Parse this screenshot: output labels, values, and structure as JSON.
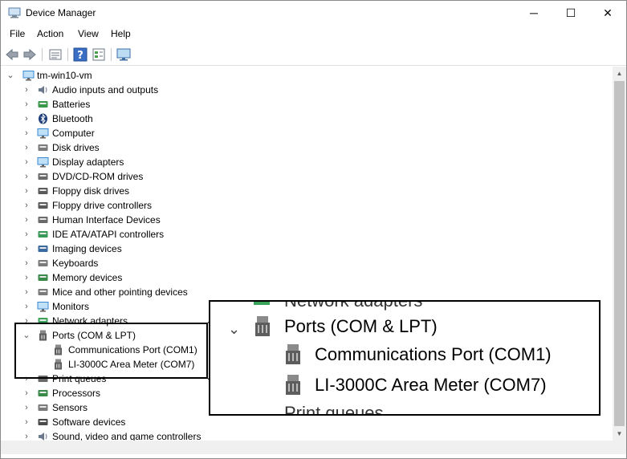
{
  "window": {
    "title": "Device Manager",
    "controls": {
      "minimize": "─",
      "maximize": "☐",
      "close": "✕"
    }
  },
  "menu": [
    "File",
    "Action",
    "View",
    "Help"
  ],
  "toolbar": [
    "back-icon",
    "forward-icon",
    "properties-icon",
    "help-icon",
    "view-icon",
    "monitor-icon"
  ],
  "tree": {
    "root": "tm-win10-vm",
    "categories": [
      {
        "label": "Audio inputs and outputs",
        "icon": "speaker-icon"
      },
      {
        "label": "Batteries",
        "icon": "battery-icon"
      },
      {
        "label": "Bluetooth",
        "icon": "bluetooth-icon"
      },
      {
        "label": "Computer",
        "icon": "computer-icon"
      },
      {
        "label": "Disk drives",
        "icon": "disk-icon"
      },
      {
        "label": "Display adapters",
        "icon": "display-icon"
      },
      {
        "label": "DVD/CD-ROM drives",
        "icon": "dvd-icon"
      },
      {
        "label": "Floppy disk drives",
        "icon": "floppy-icon"
      },
      {
        "label": "Floppy drive controllers",
        "icon": "controller-icon"
      },
      {
        "label": "Human Interface Devices",
        "icon": "hid-icon"
      },
      {
        "label": "IDE ATA/ATAPI controllers",
        "icon": "ide-icon"
      },
      {
        "label": "Imaging devices",
        "icon": "camera-icon"
      },
      {
        "label": "Keyboards",
        "icon": "keyboard-icon"
      },
      {
        "label": "Memory devices",
        "icon": "memory-icon"
      },
      {
        "label": "Mice and other pointing devices",
        "icon": "mouse-icon"
      },
      {
        "label": "Monitors",
        "icon": "monitor-icon"
      },
      {
        "label": "Network adapters",
        "icon": "network-icon"
      },
      {
        "label": "Ports (COM & LPT)",
        "icon": "port-icon",
        "expanded": true,
        "children": [
          {
            "label": "Communications Port (COM1)",
            "icon": "port-icon"
          },
          {
            "label": "LI-3000C Area Meter (COM7)",
            "icon": "port-icon"
          }
        ]
      },
      {
        "label": "Print queues",
        "icon": "printer-icon"
      },
      {
        "label": "Processors",
        "icon": "processor-icon"
      },
      {
        "label": "Sensors",
        "icon": "sensor-icon"
      },
      {
        "label": "Software devices",
        "icon": "software-icon"
      },
      {
        "label": "Sound, video and game controllers",
        "icon": "sound-icon"
      }
    ]
  },
  "zoom": {
    "top_partial": "Network adapters",
    "category": "Ports (COM & LPT)",
    "children": [
      "Communications Port (COM1)",
      "LI-3000C Area Meter (COM7)"
    ],
    "bottom_partial": "Print queues"
  }
}
